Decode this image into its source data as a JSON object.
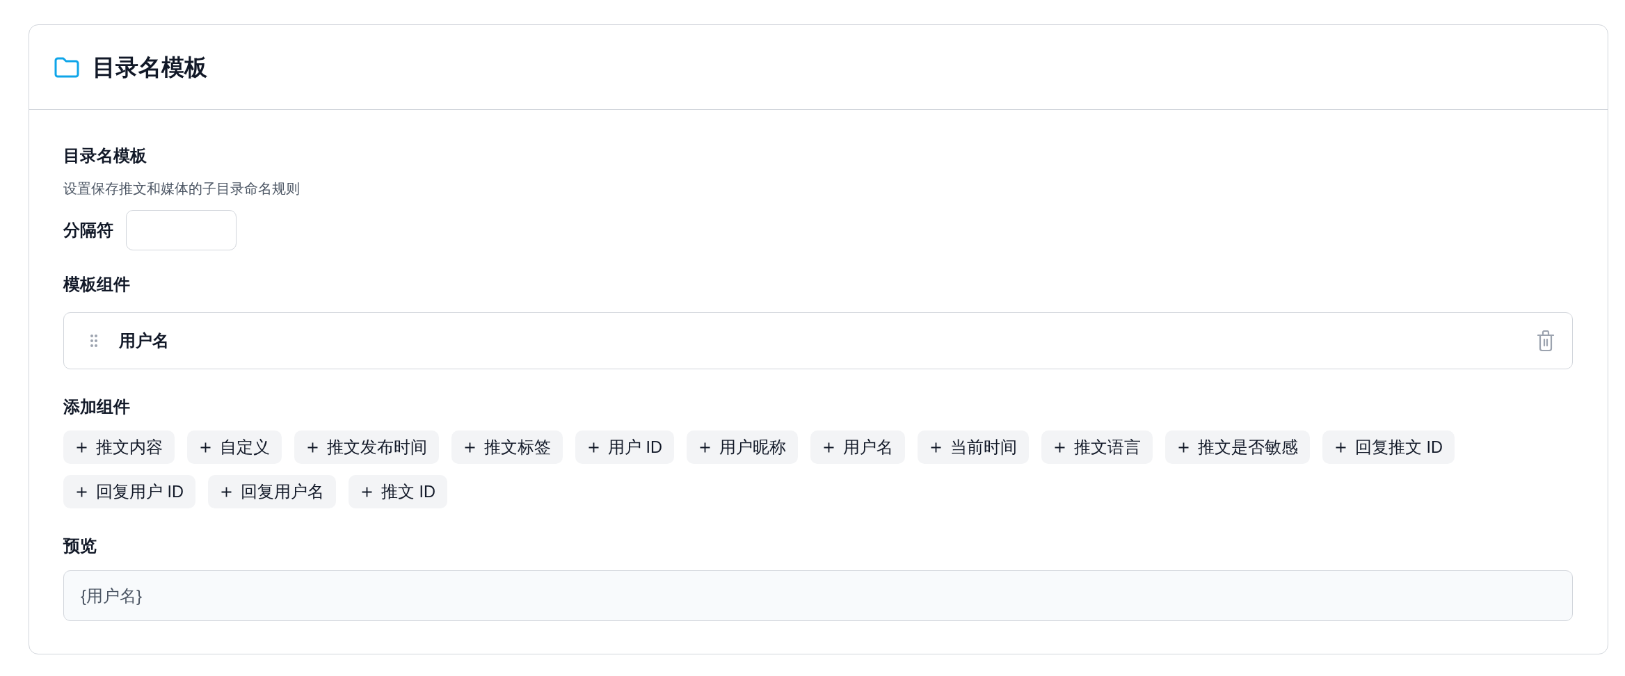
{
  "panel": {
    "title": "目录名模板"
  },
  "section": {
    "label": "目录名模板",
    "description": "设置保存推文和媒体的子目录命名规则"
  },
  "separator": {
    "label": "分隔符"
  },
  "template_components": {
    "label": "模板组件",
    "items": [
      {
        "name": "用户名"
      }
    ]
  },
  "add_components": {
    "label": "添加组件",
    "chips": [
      {
        "label": "推文内容"
      },
      {
        "label": "自定义"
      },
      {
        "label": "推文发布时间"
      },
      {
        "label": "推文标签"
      },
      {
        "label": "用户 ID"
      },
      {
        "label": "用户昵称"
      },
      {
        "label": "用户名"
      },
      {
        "label": "当前时间"
      },
      {
        "label": "推文语言"
      },
      {
        "label": "推文是否敏感"
      },
      {
        "label": "回复推文 ID"
      },
      {
        "label": "回复用户 ID"
      },
      {
        "label": "回复用户名"
      },
      {
        "label": "推文 ID"
      }
    ]
  },
  "preview": {
    "label": "预览",
    "value": "{用户名}"
  }
}
